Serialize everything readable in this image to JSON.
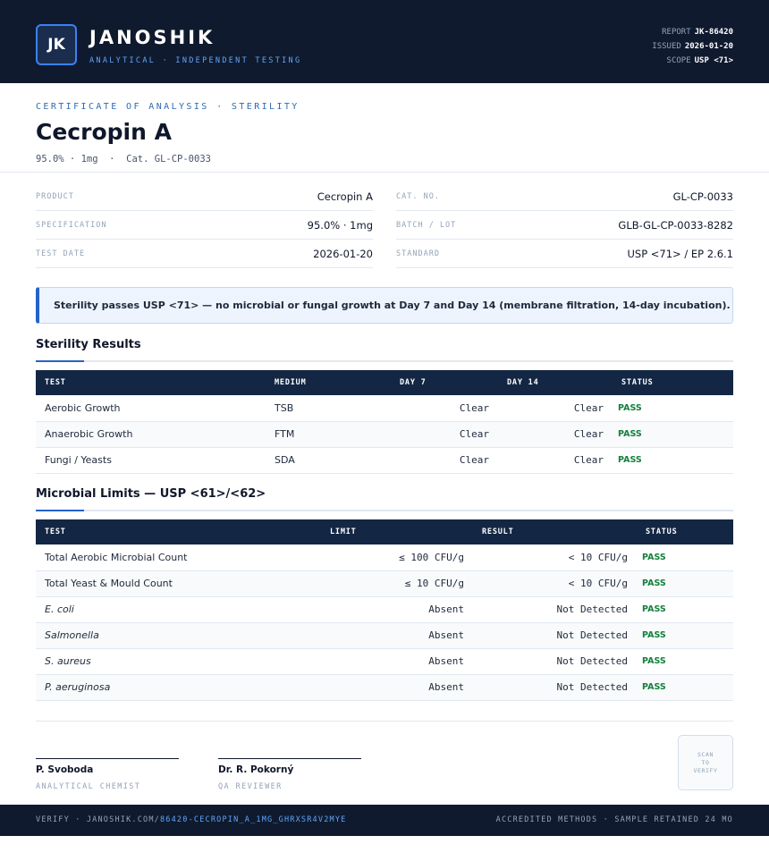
{
  "header": {
    "logo_initials": "JK",
    "brand": "JANOSHIK",
    "tagline": "ANALYTICAL · INDEPENDENT TESTING",
    "report_label": "REPORT",
    "report_value": "JK-86420",
    "issued_label": "ISSUED",
    "issued_value": "2026-01-20",
    "scope_label": "SCOPE",
    "scope_value": "USP <71>"
  },
  "title_block": {
    "cert_label": "CERTIFICATE OF ANALYSIS · STERILITY",
    "title": "Cecropin A",
    "subtitle": "95.0% · 1mg  ·  Cat. GL-CP-0033"
  },
  "info_left": [
    {
      "label": "PRODUCT",
      "value": "Cecropin A"
    },
    {
      "label": "SPECIFICATION",
      "value": "95.0% · 1mg"
    },
    {
      "label": "TEST DATE",
      "value": "2026-01-20"
    }
  ],
  "info_right": [
    {
      "label": "CAT. NO.",
      "value": "GL-CP-0033"
    },
    {
      "label": "BATCH / LOT",
      "value": "GLB-GL-CP-0033-8282"
    },
    {
      "label": "STANDARD",
      "value": "USP <71> / EP 2.6.1"
    }
  ],
  "notice": "Sterility passes USP <71> — no microbial or fungal growth at Day 7 and Day 14 (membrane filtration, 14-day incubation).",
  "sterility": {
    "title": "Sterility Results",
    "headers": [
      "TEST",
      "MEDIUM",
      "DAY 7",
      "DAY 14",
      "STATUS"
    ],
    "rows": [
      {
        "test": "Aerobic Growth",
        "medium": "TSB",
        "day7": "Clear",
        "day14": "Clear",
        "status": "PASS"
      },
      {
        "test": "Anaerobic Growth",
        "medium": "FTM",
        "day7": "Clear",
        "day14": "Clear",
        "status": "PASS"
      },
      {
        "test": "Fungi / Yeasts",
        "medium": "SDA",
        "day7": "Clear",
        "day14": "Clear",
        "status": "PASS"
      }
    ]
  },
  "microbial": {
    "title": "Microbial Limits — USP <61>/<62>",
    "headers": [
      "TEST",
      "LIMIT",
      "RESULT",
      "STATUS"
    ],
    "rows": [
      {
        "test": "Total Aerobic Microbial Count",
        "limit": "≤ 100 CFU/g",
        "result": "< 10 CFU/g",
        "status": "PASS"
      },
      {
        "test": "Total Yeast & Mould Count",
        "limit": "≤ 10 CFU/g",
        "result": "< 10 CFU/g",
        "status": "PASS"
      },
      {
        "test": "E. coli",
        "limit": "Absent",
        "result": "Not Detected",
        "status": "PASS"
      },
      {
        "test": "Salmonella",
        "limit": "Absent",
        "result": "Not Detected",
        "status": "PASS"
      },
      {
        "test": "S. aureus",
        "limit": "Absent",
        "result": "Not Detected",
        "status": "PASS"
      },
      {
        "test": "P. aeruginosa",
        "limit": "Absent",
        "result": "Not Detected",
        "status": "PASS"
      }
    ]
  },
  "signatures": [
    {
      "name": "P. Svoboda",
      "role": "ANALYTICAL CHEMIST"
    },
    {
      "name": "Dr. R. Pokorný",
      "role": "QA REVIEWER"
    }
  ],
  "qr_text": "SCAN\nTO\nVERIFY",
  "footer": {
    "verify_prefix": "VERIFY · JANOSHIK.COM/",
    "verify_link": "86420-CECROPIN_A_1MG_GHRXSR4V2MYE",
    "right": "ACCREDITED METHODS · SAMPLE RETAINED 24 MO"
  }
}
